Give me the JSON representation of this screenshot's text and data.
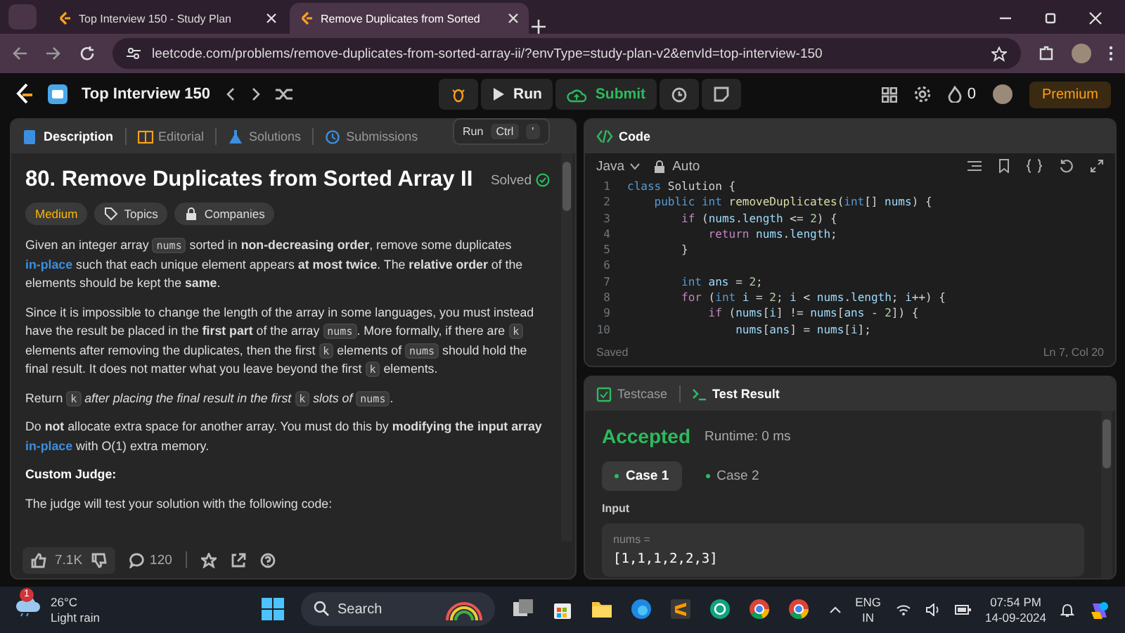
{
  "browser": {
    "tabs": [
      {
        "title": "Top Interview 150 - Study Plan",
        "selected": false
      },
      {
        "title": "Remove Duplicates from Sorted",
        "selected": true
      }
    ],
    "url": "leetcode.com/problems/remove-duplicates-from-sorted-array-ii/?envType=study-plan-v2&envId=top-interview-150"
  },
  "topbar": {
    "list_title": "Top Interview 150",
    "run": "Run",
    "submit": "Submit",
    "streak": "0",
    "premium": "Premium"
  },
  "tooltip": {
    "label": "Run",
    "keys": [
      "Ctrl",
      "'"
    ]
  },
  "description": {
    "tabs": [
      {
        "label": "Description",
        "selected": true
      },
      {
        "label": "Editorial",
        "selected": false
      },
      {
        "label": "Solutions",
        "selected": false
      },
      {
        "label": "Submissions",
        "selected": false
      }
    ],
    "title": "80. Remove Duplicates from Sorted Array II",
    "status": "Solved",
    "difficulty": "Medium",
    "tags": [
      "Topics",
      "Companies"
    ],
    "paragraphs": [
      {
        "kind": "text",
        "parts": [
          {
            "text": "Given an integer array "
          },
          {
            "code": "nums"
          },
          {
            "text": " sorted in **non-decreasing order**, remove some duplicates "
          },
          {
            "link": "in-place"
          },
          {
            "text": " such that each unique element appears **at most twice**. The **relative order** of the elements should be kept the **same**."
          }
        ]
      },
      {
        "kind": "text",
        "parts": [
          {
            "text": "Since it is impossible to change the length of the array in some languages, you must instead have the result be placed in the **first part** of the array "
          },
          {
            "code": "nums"
          },
          {
            "text": ". More formally, if there are "
          },
          {
            "code": "k"
          },
          {
            "text": " elements after removing the duplicates, then the first "
          },
          {
            "code": "k"
          },
          {
            "text": " elements of "
          },
          {
            "code": "nums"
          },
          {
            "text": " should hold the final result. It does not matter what you leave beyond the first "
          },
          {
            "code": "k"
          },
          {
            "text": " elements."
          }
        ]
      },
      {
        "kind": "text",
        "parts": [
          {
            "text": "Return "
          },
          {
            "code": "k"
          },
          {
            "text": " *after placing the final result in the first* "
          },
          {
            "code": "k"
          },
          {
            "text": " *slots of* "
          },
          {
            "code": "nums"
          },
          {
            "text": "."
          }
        ]
      },
      {
        "kind": "text",
        "parts": [
          {
            "text": "Do **not** allocate extra space for another array. You must do this by **modifying the input array** "
          },
          {
            "link": "in-place"
          },
          {
            "text": " with O(1) extra memory."
          }
        ]
      },
      {
        "kind": "heading",
        "parts": [
          {
            "text": "Custom Judge:"
          }
        ]
      },
      {
        "kind": "text",
        "parts": [
          {
            "text": "The judge will test your solution with the following code:"
          }
        ]
      }
    ],
    "likes": "7.1K",
    "comments": "120"
  },
  "editor": {
    "title": "Code",
    "language": "Java",
    "mode": "Auto",
    "lines": [
      {
        "n": "1",
        "tokens": [
          {
            "kind": "type",
            "text": "class"
          },
          {
            "kind": "plain",
            "text": " Solution {"
          }
        ]
      },
      {
        "n": "2",
        "tokens": [
          {
            "kind": "type",
            "text": "    public int "
          },
          {
            "kind": "function",
            "text": "removeDuplicates"
          },
          {
            "kind": "plain",
            "text": "("
          },
          {
            "kind": "type",
            "text": "int"
          },
          {
            "kind": "plain",
            "text": "[] "
          },
          {
            "kind": "variable",
            "text": "nums"
          },
          {
            "kind": "plain",
            "text": ") {"
          }
        ]
      },
      {
        "n": "3",
        "tokens": [
          {
            "kind": "keyword",
            "text": "        if"
          },
          {
            "kind": "plain",
            "text": " ("
          },
          {
            "kind": "variable",
            "text": "nums"
          },
          {
            "kind": "plain",
            "text": "."
          },
          {
            "kind": "variable",
            "text": "length"
          },
          {
            "kind": "plain",
            "text": " <= "
          },
          {
            "kind": "number",
            "text": "2"
          },
          {
            "kind": "plain",
            "text": ") {"
          }
        ]
      },
      {
        "n": "4",
        "tokens": [
          {
            "kind": "keyword",
            "text": "            return "
          },
          {
            "kind": "variable",
            "text": "nums"
          },
          {
            "kind": "plain",
            "text": "."
          },
          {
            "kind": "variable",
            "text": "length"
          },
          {
            "kind": "plain",
            "text": ";"
          }
        ]
      },
      {
        "n": "5",
        "tokens": [
          {
            "kind": "plain",
            "text": "        }"
          }
        ]
      },
      {
        "n": "6"
      },
      {
        "n": "7",
        "tokens": [
          {
            "kind": "type",
            "text": "        int "
          },
          {
            "kind": "variable",
            "text": "ans"
          },
          {
            "kind": "plain",
            "text": " = "
          },
          {
            "kind": "number",
            "text": "2"
          },
          {
            "kind": "plain",
            "text": ";"
          }
        ]
      },
      {
        "n": "8",
        "tokens": [
          {
            "kind": "keyword",
            "text": "        for"
          },
          {
            "kind": "plain",
            "text": " ("
          },
          {
            "kind": "type",
            "text": "int "
          },
          {
            "kind": "variable",
            "text": "i"
          },
          {
            "kind": "plain",
            "text": " = "
          },
          {
            "kind": "number",
            "text": "2"
          },
          {
            "kind": "plain",
            "text": "; "
          },
          {
            "kind": "variable",
            "text": "i"
          },
          {
            "kind": "plain",
            "text": " < "
          },
          {
            "kind": "variable",
            "text": "nums"
          },
          {
            "kind": "plain",
            "text": "."
          },
          {
            "kind": "variable",
            "text": "length"
          },
          {
            "kind": "plain",
            "text": "; "
          },
          {
            "kind": "variable",
            "text": "i"
          },
          {
            "kind": "plain",
            "text": "++) {"
          }
        ]
      },
      {
        "n": "9",
        "tokens": [
          {
            "kind": "keyword",
            "text": "            if"
          },
          {
            "kind": "plain",
            "text": " ("
          },
          {
            "kind": "variable",
            "text": "nums"
          },
          {
            "kind": "plain",
            "text": "["
          },
          {
            "kind": "variable",
            "text": "i"
          },
          {
            "kind": "plain",
            "text": "] != "
          },
          {
            "kind": "variable",
            "text": "nums"
          },
          {
            "kind": "plain",
            "text": "["
          },
          {
            "kind": "variable",
            "text": "ans"
          },
          {
            "kind": "plain",
            "text": " - "
          },
          {
            "kind": "number",
            "text": "2"
          },
          {
            "kind": "plain",
            "text": "]) {"
          }
        ]
      },
      {
        "n": "10",
        "tokens": [
          {
            "kind": "variable",
            "text": "                nums"
          },
          {
            "kind": "plain",
            "text": "["
          },
          {
            "kind": "variable",
            "text": "ans"
          },
          {
            "kind": "plain",
            "text": "] = "
          },
          {
            "kind": "variable",
            "text": "nums"
          },
          {
            "kind": "plain",
            "text": "["
          },
          {
            "kind": "variable",
            "text": "i"
          },
          {
            "kind": "plain",
            "text": "];"
          }
        ]
      }
    ],
    "status": "Saved",
    "cursor": "Ln 7, Col 20"
  },
  "results": {
    "tabs": [
      {
        "label": "Testcase",
        "selected": false
      },
      {
        "label": "Test Result",
        "selected": true
      }
    ],
    "verdict": "Accepted",
    "runtime": "Runtime: 0 ms",
    "cases": [
      {
        "label": "Case 1",
        "selected": true
      },
      {
        "label": "Case 2",
        "selected": false
      }
    ],
    "input_label": "Input",
    "param": "nums =",
    "value": "[1,1,1,2,2,3]"
  },
  "taskbar": {
    "weather": {
      "temp": "26°C",
      "condition": "Light rain",
      "badge": "1"
    },
    "search": {
      "placeholder": "Search"
    },
    "language": [
      "ENG",
      "IN"
    ],
    "time": "07:54 PM",
    "date": "14-09-2024"
  }
}
